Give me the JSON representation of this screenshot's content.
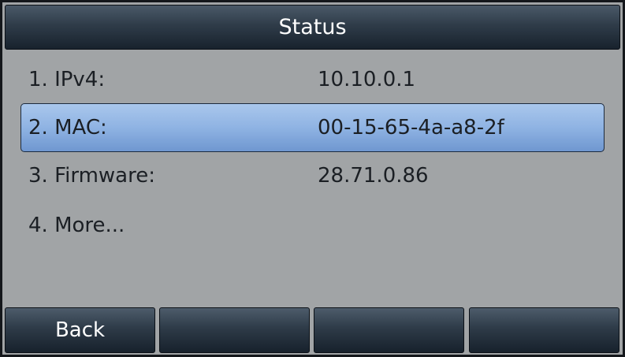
{
  "title": "Status",
  "menu": [
    {
      "label": "1. IPv4:",
      "value": "10.10.0.1",
      "selected": false
    },
    {
      "label": "2. MAC:",
      "value": "00-15-65-4a-a8-2f",
      "selected": true
    },
    {
      "label": "3. Firmware:",
      "value": "28.71.0.86",
      "selected": false
    },
    {
      "label": "4. More...",
      "value": "",
      "selected": false
    }
  ],
  "softkeys": [
    "Back",
    "",
    "",
    ""
  ]
}
